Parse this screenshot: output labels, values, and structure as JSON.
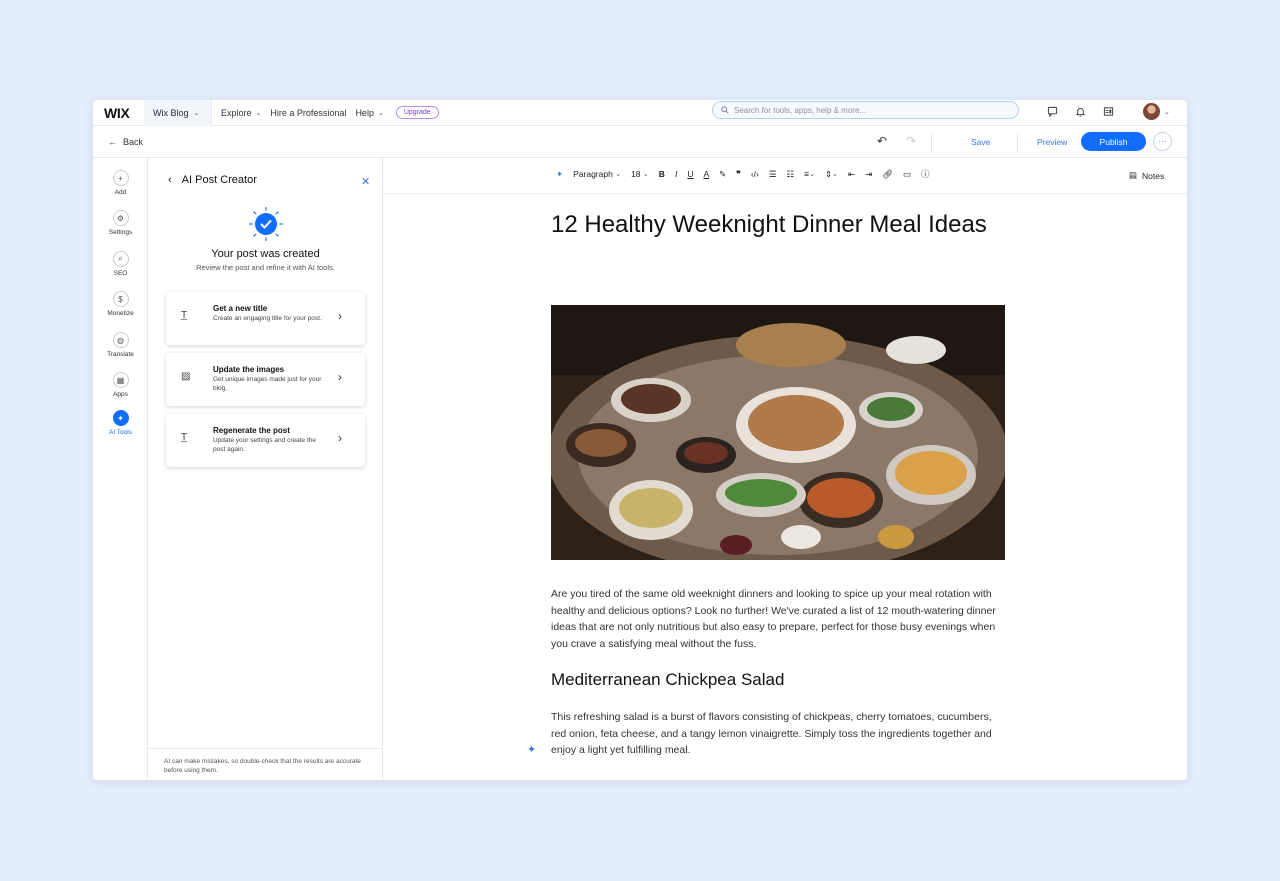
{
  "topbar": {
    "logo": "WIX",
    "site": "Wix Blog",
    "nav": [
      "Explore",
      "Hire a Professional",
      "Help"
    ],
    "upgrade": "Upgrade",
    "search_placeholder": "Search for tools, apps, help & more..."
  },
  "actions": {
    "back": "Back",
    "save": "Save",
    "preview": "Preview",
    "publish": "Publish",
    "more": "···"
  },
  "rail": [
    {
      "label": "Add",
      "icon": "plus-icon"
    },
    {
      "label": "Settings",
      "icon": "gear-icon"
    },
    {
      "label": "SEO",
      "icon": "search-icon"
    },
    {
      "label": "Monetize",
      "icon": "dollar-icon"
    },
    {
      "label": "Translate",
      "icon": "globe-icon"
    },
    {
      "label": "Apps",
      "icon": "apps-icon"
    },
    {
      "label": "AI Tools",
      "icon": "sparkle-icon"
    }
  ],
  "panel": {
    "title": "AI Post Creator",
    "created_title": "Your post was created",
    "created_sub": "Review the post and refine it with AI tools.",
    "cards": [
      {
        "title": "Get a new title",
        "desc": "Create an engaging title for your post."
      },
      {
        "title": "Update the images",
        "desc": "Get unique images made just for your blog."
      },
      {
        "title": "Regenerate the post",
        "desc": "Update your settings and create the post again."
      }
    ],
    "footer": "AI can make mistakes, so double-check that the results are accurate before using them."
  },
  "toolbar": {
    "style": "Paragraph",
    "size": "18",
    "notes": "Notes"
  },
  "article": {
    "title": "12 Healthy Weeknight Dinner Meal Ideas",
    "intro": "Are you tired of the same old weeknight dinners and looking to spice up your meal rotation with healthy and delicious options? Look no further! We've curated a list of 12 mouth-watering dinner ideas that are not only nutritious but also easy to prepare, perfect for those busy evenings when you crave a satisfying meal without the fuss.",
    "section_title": "Mediterranean Chickpea Salad",
    "section_text": "This refreshing salad is a burst of flavors consisting of chickpeas, cherry tomatoes, cucumbers, red onion, feta cheese, and a tangy lemon vinaigrette. Simply toss the ingredients together and enjoy a light yet fulfilling meal."
  },
  "colors": {
    "accent": "#116dff",
    "background": "#e4eefc"
  }
}
